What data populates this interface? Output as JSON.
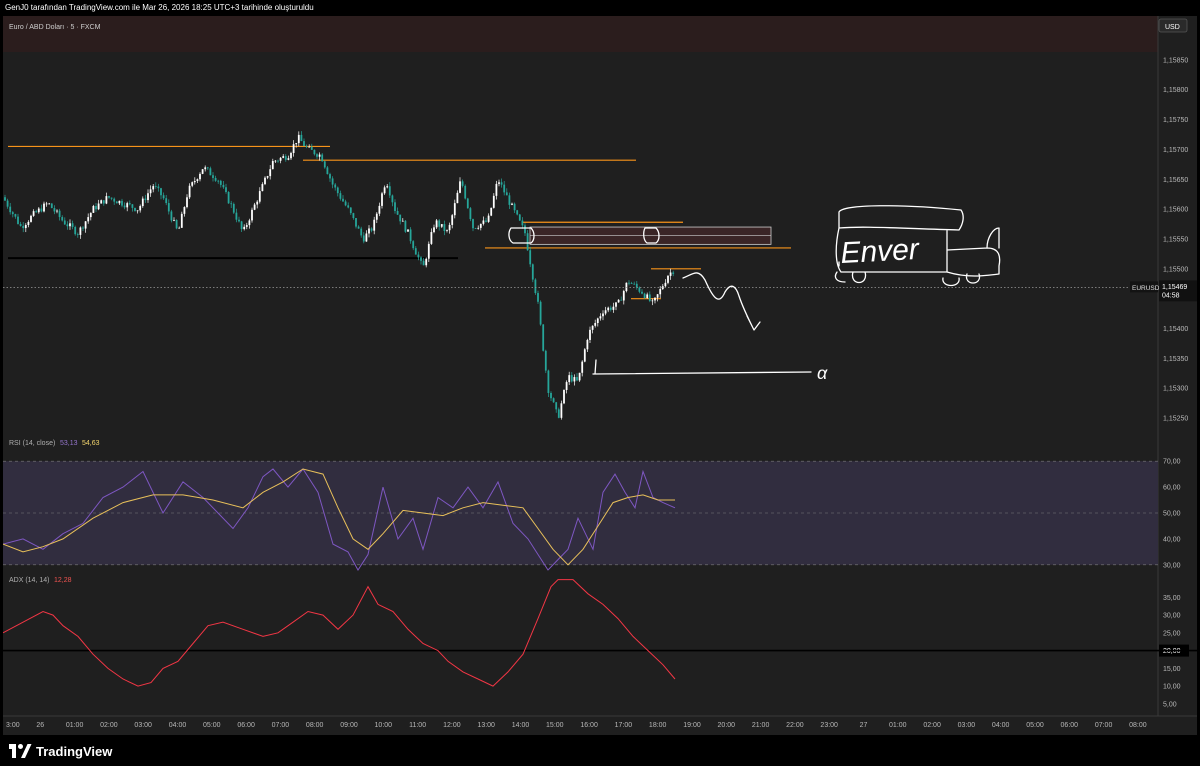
{
  "header_text": "GenJ0 tarafından TradingView.com ile Mar 26, 2026 18:25 UTC+3 tarihinde oluşturuldu",
  "symbol_title": "Euro / ABD Doları · 5 · FXCM",
  "currency_label": "USD",
  "brand": "TradingView",
  "price": {
    "ticks": [
      "1,15850",
      "1,15800",
      "1,15750",
      "1,15700",
      "1,15650",
      "1,15600",
      "1,15550",
      "1,15500",
      "1,15400",
      "1,15350",
      "1,15300",
      "1,15250"
    ],
    "ymin": 1.1522,
    "ymax": 1.1589,
    "current_symbol": "EURUSD",
    "current_value": "1,15469",
    "countdown": "04:58",
    "current_price": 1.15469
  },
  "time_axis": [
    "3:00",
    "26",
    "01:00",
    "02:00",
    "03:00",
    "04:00",
    "05:00",
    "06:00",
    "07:00",
    "08:00",
    "09:00",
    "10:00",
    "11:00",
    "12:00",
    "13:00",
    "14:00",
    "15:00",
    "16:00",
    "17:00",
    "18:00",
    "19:00",
    "20:00",
    "21:00",
    "22:00",
    "23:00",
    "27",
    "01:00",
    "02:00",
    "03:00",
    "04:00",
    "05:00",
    "06:00",
    "07:00",
    "08:00"
  ],
  "rsi": {
    "label": "RSI (14, close)",
    "value1": "53,13",
    "value2": "54,63",
    "ticks": [
      "70,00",
      "60,00",
      "50,00",
      "40,00",
      "30,00"
    ],
    "band_low": 30,
    "band_high": 70
  },
  "adx": {
    "label": "ADX (14, 14)",
    "value": "12,28",
    "ticks": [
      "35,00",
      "30,00",
      "25,00",
      "15,00",
      "10,00",
      "5,00"
    ],
    "level_label": "20,00",
    "level": 20
  },
  "annotations": {
    "handwriting": "Enver",
    "arrow_glyph": "α"
  },
  "colors": {
    "bull": "#ffffff",
    "bear": "#26a69a",
    "level_orange": "#f7931a",
    "rsi_line": "#7e57c2",
    "rsi_ma": "#e8c05a",
    "adx_line": "#f23645",
    "panel_bg": "#1f1f1f",
    "rsi_band": "#312d3f"
  },
  "chart_data": {
    "type": "candlestick",
    "instrument": "EURUSD 5m",
    "ylim": [
      1.1522,
      1.1589
    ],
    "price_path": [
      [
        0,
        1.1562
      ],
      [
        18,
        1.1557
      ],
      [
        30,
        1.1559
      ],
      [
        45,
        1.1561
      ],
      [
        60,
        1.1558
      ],
      [
        75,
        1.1556
      ],
      [
        90,
        1.156
      ],
      [
        105,
        1.1562
      ],
      [
        120,
        1.1561
      ],
      [
        135,
        1.156
      ],
      [
        150,
        1.1564
      ],
      [
        160,
        1.1562
      ],
      [
        175,
        1.1556
      ],
      [
        185,
        1.1563
      ],
      [
        200,
        1.1567
      ],
      [
        215,
        1.1565
      ],
      [
        230,
        1.156
      ],
      [
        240,
        1.1556
      ],
      [
        255,
        1.1562
      ],
      [
        270,
        1.1568
      ],
      [
        285,
        1.1569
      ],
      [
        295,
        1.1572
      ],
      [
        305,
        1.157
      ],
      [
        318,
        1.1569
      ],
      [
        330,
        1.1564
      ],
      [
        345,
        1.156
      ],
      [
        360,
        1.1555
      ],
      [
        370,
        1.1557
      ],
      [
        383,
        1.1565
      ],
      [
        392,
        1.156
      ],
      [
        405,
        1.1556
      ],
      [
        420,
        1.155
      ],
      [
        432,
        1.1558
      ],
      [
        445,
        1.1556
      ],
      [
        458,
        1.1565
      ],
      [
        470,
        1.1557
      ],
      [
        485,
        1.1558
      ],
      [
        495,
        1.1565
      ],
      [
        510,
        1.156
      ],
      [
        522,
        1.1556
      ],
      [
        535,
        1.1544
      ],
      [
        545,
        1.153
      ],
      [
        555,
        1.1525
      ],
      [
        565,
        1.1532
      ],
      [
        575,
        1.1531
      ],
      [
        585,
        1.1539
      ],
      [
        600,
        1.1543
      ],
      [
        615,
        1.1544
      ],
      [
        625,
        1.1548
      ],
      [
        640,
        1.1546
      ],
      [
        650,
        1.1544
      ],
      [
        665,
        1.1549
      ],
      [
        672,
        1.155
      ]
    ],
    "levels": [
      {
        "x1": 5,
        "x2": 327,
        "y": 1.15705,
        "color": "orange"
      },
      {
        "x1": 300,
        "x2": 633,
        "y": 1.15682,
        "color": "orange"
      },
      {
        "x1": 5,
        "x2": 455,
        "y": 1.15518,
        "color": "black"
      },
      {
        "x1": 482,
        "x2": 788,
        "y": 1.15535,
        "color": "orange"
      },
      {
        "x1": 520,
        "x2": 680,
        "y": 1.15578,
        "color": "orange"
      },
      {
        "x1": 648,
        "x2": 698,
        "y": 1.155,
        "color": "orange"
      },
      {
        "x1": 628,
        "x2": 658,
        "y": 1.1545,
        "color": "orange"
      }
    ],
    "zone": {
      "x1": 527,
      "x2": 768,
      "y_top": 1.1557,
      "y_bottom": 1.15541
    },
    "rsi_series": [
      [
        0,
        38
      ],
      [
        20,
        40
      ],
      [
        40,
        36
      ],
      [
        60,
        42
      ],
      [
        80,
        46
      ],
      [
        100,
        56
      ],
      [
        120,
        60
      ],
      [
        140,
        66
      ],
      [
        160,
        50
      ],
      [
        180,
        62
      ],
      [
        200,
        56
      ],
      [
        215,
        50
      ],
      [
        230,
        44
      ],
      [
        245,
        52
      ],
      [
        260,
        64
      ],
      [
        270,
        67
      ],
      [
        285,
        60
      ],
      [
        300,
        67
      ],
      [
        315,
        58
      ],
      [
        330,
        38
      ],
      [
        345,
        35
      ],
      [
        355,
        28
      ],
      [
        365,
        34
      ],
      [
        380,
        60
      ],
      [
        395,
        40
      ],
      [
        410,
        48
      ],
      [
        420,
        36
      ],
      [
        435,
        56
      ],
      [
        450,
        52
      ],
      [
        465,
        60
      ],
      [
        480,
        52
      ],
      [
        495,
        62
      ],
      [
        510,
        46
      ],
      [
        525,
        40
      ],
      [
        535,
        34
      ],
      [
        545,
        28
      ],
      [
        555,
        32
      ],
      [
        565,
        36
      ],
      [
        575,
        48
      ],
      [
        590,
        36
      ],
      [
        600,
        58
      ],
      [
        612,
        65
      ],
      [
        622,
        58
      ],
      [
        632,
        52
      ],
      [
        640,
        66
      ],
      [
        650,
        56
      ],
      [
        660,
        54
      ],
      [
        672,
        52
      ]
    ],
    "rsi_ma_series": [
      [
        0,
        38
      ],
      [
        20,
        35
      ],
      [
        40,
        37
      ],
      [
        60,
        40
      ],
      [
        90,
        48
      ],
      [
        120,
        54
      ],
      [
        150,
        57
      ],
      [
        180,
        57
      ],
      [
        210,
        55
      ],
      [
        240,
        52
      ],
      [
        260,
        58
      ],
      [
        280,
        62
      ],
      [
        300,
        67
      ],
      [
        320,
        65
      ],
      [
        335,
        52
      ],
      [
        350,
        40
      ],
      [
        365,
        36
      ],
      [
        380,
        42
      ],
      [
        400,
        51
      ],
      [
        420,
        50
      ],
      [
        440,
        49
      ],
      [
        460,
        52
      ],
      [
        480,
        54
      ],
      [
        500,
        53
      ],
      [
        520,
        52
      ],
      [
        535,
        44
      ],
      [
        550,
        36
      ],
      [
        565,
        30
      ],
      [
        580,
        36
      ],
      [
        595,
        45
      ],
      [
        610,
        54
      ],
      [
        625,
        56
      ],
      [
        640,
        57
      ],
      [
        655,
        55
      ],
      [
        672,
        55
      ]
    ],
    "adx_series": [
      [
        0,
        25
      ],
      [
        20,
        28
      ],
      [
        40,
        31
      ],
      [
        50,
        30
      ],
      [
        60,
        27
      ],
      [
        75,
        24
      ],
      [
        90,
        19
      ],
      [
        105,
        15
      ],
      [
        120,
        12
      ],
      [
        135,
        10
      ],
      [
        148,
        11
      ],
      [
        160,
        15
      ],
      [
        175,
        17
      ],
      [
        190,
        22
      ],
      [
        205,
        27
      ],
      [
        220,
        28
      ],
      [
        240,
        26
      ],
      [
        260,
        24
      ],
      [
        275,
        25
      ],
      [
        290,
        28
      ],
      [
        305,
        31
      ],
      [
        320,
        30
      ],
      [
        335,
        26
      ],
      [
        350,
        30
      ],
      [
        365,
        38
      ],
      [
        375,
        33
      ],
      [
        390,
        31
      ],
      [
        405,
        26
      ],
      [
        420,
        22
      ],
      [
        435,
        20
      ],
      [
        445,
        17
      ],
      [
        460,
        14
      ],
      [
        475,
        12
      ],
      [
        490,
        10
      ],
      [
        505,
        14
      ],
      [
        520,
        19
      ],
      [
        535,
        29
      ],
      [
        548,
        38
      ],
      [
        555,
        40
      ],
      [
        570,
        40
      ],
      [
        585,
        36
      ],
      [
        600,
        33
      ],
      [
        615,
        29
      ],
      [
        630,
        24
      ],
      [
        645,
        20
      ],
      [
        660,
        16
      ],
      [
        672,
        12
      ]
    ]
  }
}
